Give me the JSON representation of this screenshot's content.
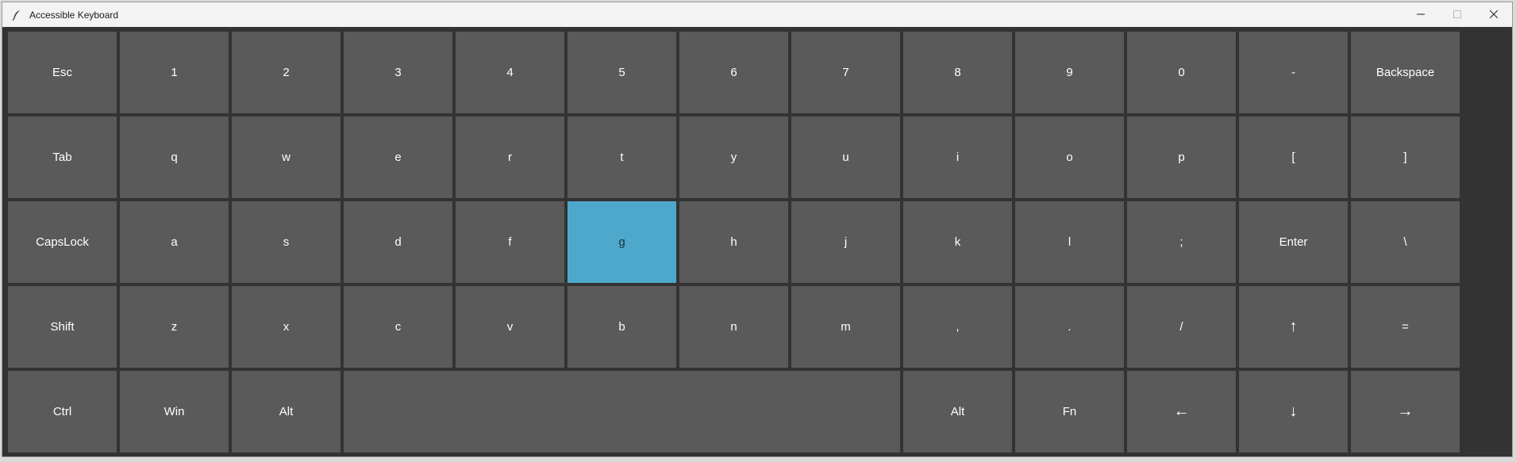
{
  "window": {
    "title": "Accessible Keyboard",
    "controls": {
      "minimize_icon": "minimize-icon",
      "maximize_icon": "maximize-icon",
      "close_icon": "close-icon"
    }
  },
  "colors": {
    "window_background": "#333333",
    "key_background": "#5a5a5a",
    "key_text": "#ffffff",
    "highlight": "#4ea8cc",
    "titlebar": "#f3f3f3"
  },
  "keyboard": {
    "highlighted_key": "g",
    "rows": [
      [
        {
          "label": "Esc",
          "name": "key-esc"
        },
        {
          "label": "1",
          "name": "key-1"
        },
        {
          "label": "2",
          "name": "key-2"
        },
        {
          "label": "3",
          "name": "key-3"
        },
        {
          "label": "4",
          "name": "key-4"
        },
        {
          "label": "5",
          "name": "key-5"
        },
        {
          "label": "6",
          "name": "key-6"
        },
        {
          "label": "7",
          "name": "key-7"
        },
        {
          "label": "8",
          "name": "key-8"
        },
        {
          "label": "9",
          "name": "key-9"
        },
        {
          "label": "0",
          "name": "key-0"
        },
        {
          "label": "-",
          "name": "key-minus"
        },
        {
          "label": "Backspace",
          "name": "key-backspace"
        }
      ],
      [
        {
          "label": "Tab",
          "name": "key-tab"
        },
        {
          "label": "q",
          "name": "key-q"
        },
        {
          "label": "w",
          "name": "key-w"
        },
        {
          "label": "e",
          "name": "key-e"
        },
        {
          "label": "r",
          "name": "key-r"
        },
        {
          "label": "t",
          "name": "key-t"
        },
        {
          "label": "y",
          "name": "key-y"
        },
        {
          "label": "u",
          "name": "key-u"
        },
        {
          "label": "i",
          "name": "key-i"
        },
        {
          "label": "o",
          "name": "key-o"
        },
        {
          "label": "p",
          "name": "key-p"
        },
        {
          "label": "[",
          "name": "key-left-bracket"
        },
        {
          "label": "]",
          "name": "key-right-bracket"
        }
      ],
      [
        {
          "label": "CapsLock",
          "name": "key-capslock"
        },
        {
          "label": "a",
          "name": "key-a"
        },
        {
          "label": "s",
          "name": "key-s"
        },
        {
          "label": "d",
          "name": "key-d"
        },
        {
          "label": "f",
          "name": "key-f"
        },
        {
          "label": "g",
          "name": "key-g",
          "highlighted": true
        },
        {
          "label": "h",
          "name": "key-h"
        },
        {
          "label": "j",
          "name": "key-j"
        },
        {
          "label": "k",
          "name": "key-k"
        },
        {
          "label": "l",
          "name": "key-l"
        },
        {
          "label": ";",
          "name": "key-semicolon"
        },
        {
          "label": "Enter",
          "name": "key-enter"
        },
        {
          "label": "\\",
          "name": "key-backslash"
        }
      ],
      [
        {
          "label": "Shift",
          "name": "key-shift"
        },
        {
          "label": "z",
          "name": "key-z"
        },
        {
          "label": "x",
          "name": "key-x"
        },
        {
          "label": "c",
          "name": "key-c"
        },
        {
          "label": "v",
          "name": "key-v"
        },
        {
          "label": "b",
          "name": "key-b"
        },
        {
          "label": "n",
          "name": "key-n"
        },
        {
          "label": "m",
          "name": "key-m"
        },
        {
          "label": ",",
          "name": "key-comma"
        },
        {
          "label": ".",
          "name": "key-period"
        },
        {
          "label": "/",
          "name": "key-slash"
        },
        {
          "label": "↑",
          "name": "key-arrow-up",
          "arrow": true
        },
        {
          "label": "=",
          "name": "key-equals"
        }
      ],
      [
        {
          "label": "Ctrl",
          "name": "key-ctrl"
        },
        {
          "label": "Win",
          "name": "key-win"
        },
        {
          "label": "Alt",
          "name": "key-alt-left"
        },
        {
          "label": "",
          "name": "key-space",
          "space": true
        },
        {
          "label": "Alt",
          "name": "key-alt-right"
        },
        {
          "label": "Fn",
          "name": "key-fn"
        },
        {
          "label": "←",
          "name": "key-arrow-left",
          "arrow": true
        },
        {
          "label": "↓",
          "name": "key-arrow-down",
          "arrow": true
        },
        {
          "label": "→",
          "name": "key-arrow-right",
          "arrow": true
        }
      ]
    ]
  }
}
